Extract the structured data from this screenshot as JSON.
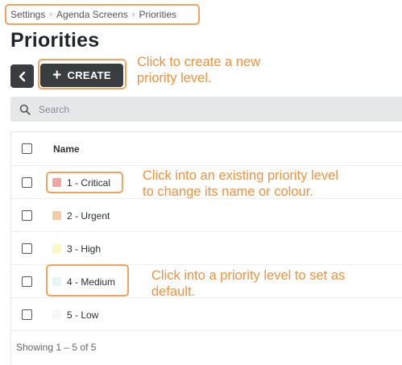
{
  "breadcrumb": {
    "items": [
      "Settings",
      "Agenda Screens",
      "Priorities"
    ]
  },
  "page": {
    "title": "Priorities"
  },
  "toolbar": {
    "back_icon": "chevron-left-icon",
    "create_icon": "plus-icon",
    "create_label": "CREATE"
  },
  "search": {
    "placeholder": "Search",
    "value": "",
    "icon": "search-icon"
  },
  "table": {
    "columns": [
      "Name"
    ],
    "rows": [
      {
        "label": "1 - Critical",
        "color": "#f4a3a3"
      },
      {
        "label": "2 - Urgent",
        "color": "#f6cba1"
      },
      {
        "label": "3 - High",
        "color": "#fafac0"
      },
      {
        "label": "4 - Medium",
        "color": "#e3f8f4"
      },
      {
        "label": "5 - Low",
        "color": "#f7f7f7"
      }
    ],
    "footer": "Showing 1 – 5 of 5"
  },
  "annotations": {
    "create": [
      "Click to create a new",
      "priority level."
    ],
    "existing": [
      "Click into an existing priority level",
      "to change its name or colour."
    ],
    "default": [
      "Click into a priority level to set as",
      "default."
    ]
  },
  "colors": {
    "annotation": "#f2913d",
    "highlight_border": "#f2a25c",
    "button_bg": "#3a3d40",
    "search_bg": "#e5e7e9"
  }
}
